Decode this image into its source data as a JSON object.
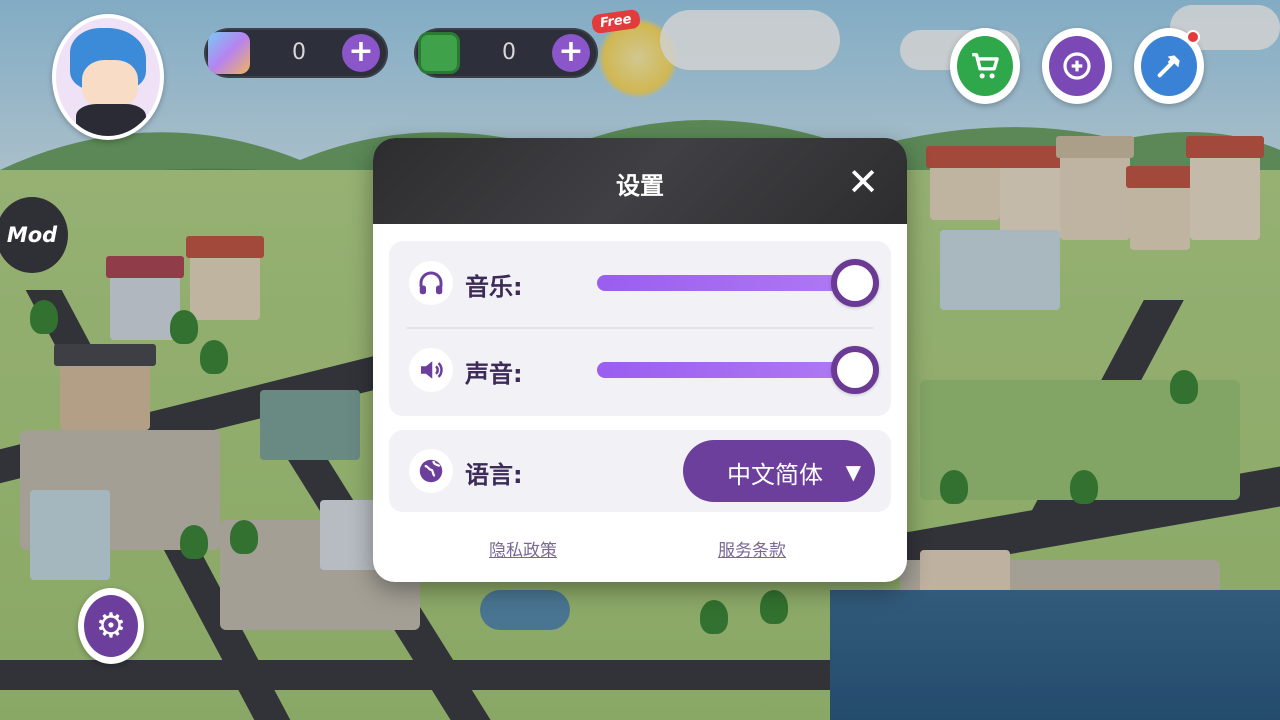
{
  "hud": {
    "gems_value": "0",
    "cash_value": "0",
    "free_badge": "Free",
    "mod_badge": "Mod",
    "plus_symbol": "+"
  },
  "icons": {
    "shop": "shopping-cart-icon",
    "gift": "gift-icon",
    "build": "hammer-icon",
    "settings": "gear-icon",
    "music": "headphones-icon",
    "sound": "speaker-icon",
    "language": "globe-icon"
  },
  "settings": {
    "title": "设置",
    "close_symbol": "✕",
    "music_label": "音乐:",
    "music_level": 1.0,
    "sound_label": "声音:",
    "sound_level": 1.0,
    "language_label": "语言:",
    "language_value": "中文简体",
    "caret_symbol": "▼",
    "privacy_link": "隐私政策",
    "terms_link": "服务条款"
  },
  "colors": {
    "accent_purple": "#6d3f9c",
    "slider_fill": "#9a5ef0",
    "header_dark": "#2d2d2f",
    "badge_red": "#e33b3b"
  }
}
